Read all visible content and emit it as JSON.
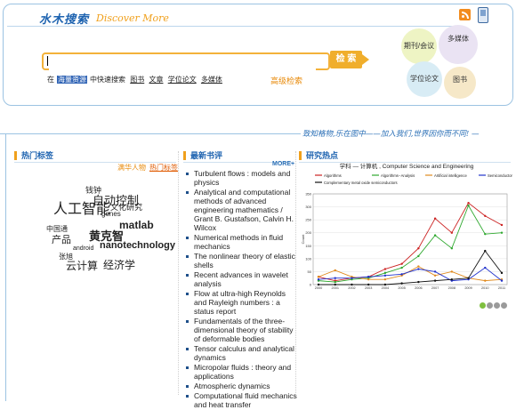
{
  "header": {
    "logo_cn": "水木搜索",
    "logo_en": "Discover More",
    "rss_icon": "rss-icon",
    "mobile_icon": "mobile-phone-icon"
  },
  "search": {
    "value": "",
    "placeholder": "",
    "button_label": "检 索",
    "scope_prefix": "在",
    "scope_selected": "海量资源",
    "scope_suffix": "中快速搜索",
    "filters": [
      "图书",
      "文章",
      "学位论文",
      "多媒体"
    ],
    "advanced_label": "高级检索"
  },
  "circles": {
    "journal": "期刊/会议",
    "media": "多媒体",
    "thesis": "学位论文",
    "book": "图书"
  },
  "slogan": "致知格物,乐在图中——加入我们,世界因你而不同! —",
  "hot_tags": {
    "title": "热门标签",
    "tab_people": "满华人物",
    "tab_hot": "热门标签",
    "cloud": [
      {
        "text": "钱钟",
        "color": "#c8c89a"
      },
      {
        "text": "自动控制",
        "color": "#b9c97a"
      },
      {
        "text": "人工智能",
        "color": "#8a8a3a"
      },
      {
        "text": "文化研究",
        "color": "#c6d39a"
      },
      {
        "text": "genes",
        "color": "#c0c89a"
      },
      {
        "text": "matlab",
        "color": "#8a7a3a"
      },
      {
        "text": "中国通",
        "color": "#c8c0a0"
      },
      {
        "text": "产品",
        "color": "#b7a36a"
      },
      {
        "text": "黄克智",
        "color": "#9a8a5a"
      },
      {
        "text": "nanotechnology",
        "color": "#8ab63a"
      },
      {
        "text": "android",
        "color": "#c8c8b0"
      },
      {
        "text": "张旭",
        "color": "#c8c8b0"
      },
      {
        "text": "云计算",
        "color": "#b2a66a"
      },
      {
        "text": "经济学",
        "color": "#bdb07a"
      }
    ]
  },
  "new_reviews": {
    "title": "最新书评",
    "more_label": "MORE+",
    "books": [
      "Turbulent flows : models and physics",
      "Analytical and computational methods of advanced engineering mathematics / Grant B. Gustafson, Calvin H. Wilcox",
      "Numerical methods in fluid mechanics",
      "The nonlinear theory of elastic shells",
      "Recent advances in wavelet analysis",
      "Flow at ultra-high Reynolds and Rayleigh numbers : a status report",
      "Fundamentals of the three-dimensional theory of stability of deformable bodies",
      "Tensor calculus and analytical dynamics",
      "Micropolar fluids : theory and applications",
      "Atmospheric dynamics",
      "Computational fluid mechanics and heat transfer"
    ]
  },
  "research": {
    "title": "研究热点",
    "dots": 4,
    "active_dot": 0
  },
  "chart_data": {
    "type": "line",
    "title": "学科 — 计算机 , Computer Science and Engineering",
    "xlabel": "",
    "ylabel": "Count",
    "x": [
      "2000",
      "2001",
      "2002",
      "2003",
      "2004",
      "2005",
      "2006",
      "2007",
      "2008",
      "2009",
      "2010",
      "2011"
    ],
    "ylim": [
      0,
      350
    ],
    "yticks": [
      0,
      50,
      100,
      150,
      200,
      250,
      300,
      350
    ],
    "grid": true,
    "legend_placement": "top",
    "series": [
      {
        "name": "Algorithms",
        "color": "#cc2222",
        "values": [
          30,
          15,
          25,
          30,
          60,
          80,
          140,
          255,
          200,
          315,
          265,
          230
        ]
      },
      {
        "name": "Algorithms--Analysis",
        "color": "#2ea82e",
        "values": [
          15,
          10,
          20,
          25,
          45,
          65,
          110,
          190,
          140,
          305,
          195,
          200
        ]
      },
      {
        "name": "Artificial intelligence",
        "color": "#e08a1e",
        "values": [
          30,
          55,
          30,
          20,
          20,
          35,
          70,
          35,
          50,
          25,
          15,
          20
        ]
      },
      {
        "name": "Semiconductor industry",
        "color": "#2233cc",
        "values": [
          20,
          25,
          25,
          30,
          35,
          40,
          60,
          50,
          15,
          20,
          65,
          15
        ]
      },
      {
        "name": "Complementary metal oxide semiconductors",
        "color": "#111111",
        "values": [
          0,
          0,
          0,
          0,
          0,
          5,
          10,
          15,
          20,
          25,
          130,
          45
        ]
      }
    ]
  }
}
